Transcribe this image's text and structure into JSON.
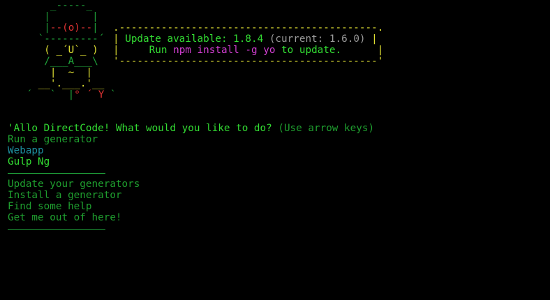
{
  "colors": {
    "background": "#000000",
    "border": "#1fa33a",
    "bright_green": "#33dd33",
    "dim_green": "#1f9f2f",
    "cyan": "#1e8fa0",
    "magenta": "#d43fd4",
    "yellow": "#e0e033",
    "red": "#e03333",
    "gray": "#9a9a9a"
  },
  "mascot": {
    "line1": "        _-----_",
    "line2_a": "       |       |",
    "line3_a": "       |",
    "line3_eyes": "--(o)--",
    "line3_b": "|",
    "line4": "      `---------´",
    "line5": "       ( _´U`_ )",
    "line6": "       /___A___\\",
    "line7": "        |  ~  |",
    "line8": "      __'.___.'__",
    "line9_a": "    ´   `  |",
    "line9_deg": "° ",
    "line9_y": "´ Y",
    "line9_b": " `"
  },
  "update_box": {
    "top_border": ".-------------------------------------------.",
    "bottom_border": "'-------------------------------------------'",
    "edge": "|",
    "line1_label": "Update available: 1.8.4",
    "line1_current": "(current: 1.6.0)",
    "line2_prefix": "Run",
    "line2_command": "npm install -g yo",
    "line2_suffix": "to update."
  },
  "prompt": {
    "question": "'Allo DirectCode! What would you like to do?",
    "hint": "(Use arrow keys)"
  },
  "menu": {
    "items_top": [
      {
        "label": "Run a generator",
        "state": "section"
      },
      {
        "label": "Webapp",
        "state": "option"
      },
      {
        "label": "Gulp Ng",
        "state": "selected"
      }
    ],
    "items_bottom": [
      {
        "label": "Update your generators"
      },
      {
        "label": "Install a generator"
      },
      {
        "label": "Find some help"
      },
      {
        "label": "Get me out of here!"
      }
    ]
  }
}
